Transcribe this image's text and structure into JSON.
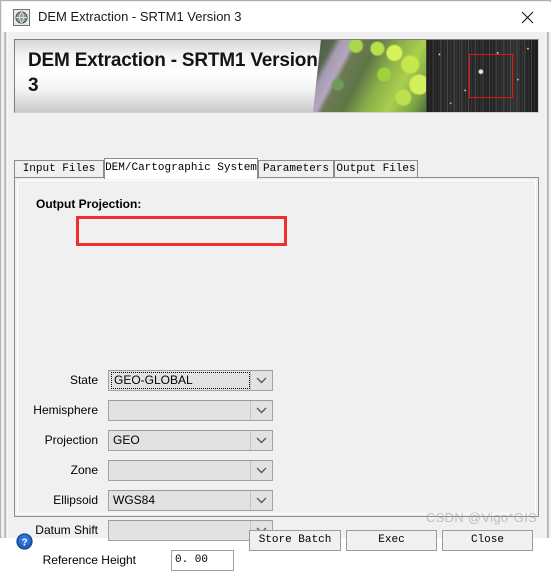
{
  "window": {
    "title": "DEM Extraction - SRTM1 Version 3",
    "icon": "globe-icon",
    "close_label": "✕"
  },
  "banner": {
    "title": "DEM Extraction - SRTM1 Version 3",
    "art": {
      "left_panel": "aerial-color-image",
      "right_panel": "sar-grayscale-image",
      "selection_box_color": "#ee1111"
    }
  },
  "tabs": [
    {
      "label": "Input Files",
      "active": false
    },
    {
      "label": "DEM/Cartographic System",
      "active": true
    },
    {
      "label": "Parameters",
      "active": false
    },
    {
      "label": "Output Files",
      "active": false
    }
  ],
  "panel": {
    "section_title": "Output Projection:",
    "fields": [
      {
        "label": "State",
        "type": "combo",
        "value": "GEO-GLOBAL",
        "focused": true,
        "highlighted": true
      },
      {
        "label": "Hemisphere",
        "type": "combo",
        "value": "",
        "focused": false,
        "highlighted": false
      },
      {
        "label": "Projection",
        "type": "combo",
        "value": "GEO",
        "focused": false,
        "highlighted": false
      },
      {
        "label": "Zone",
        "type": "combo",
        "value": "",
        "focused": false,
        "highlighted": false
      },
      {
        "label": "Ellipsoid",
        "type": "combo",
        "value": "WGS84",
        "focused": false,
        "highlighted": false
      },
      {
        "label": "Datum Shift",
        "type": "combo",
        "value": "",
        "focused": false,
        "highlighted": false
      },
      {
        "label": "Reference Height",
        "type": "textbox",
        "value": "0. 00",
        "focused": false,
        "highlighted": false
      }
    ],
    "highlight_color": "#f03030"
  },
  "footer": {
    "help_icon": "help-question-icon",
    "buttons": [
      {
        "label": "Store Batch"
      },
      {
        "label": "Exec"
      },
      {
        "label": "Close"
      }
    ]
  },
  "watermark": {
    "text": "CSDN @Vigo*GIS"
  }
}
